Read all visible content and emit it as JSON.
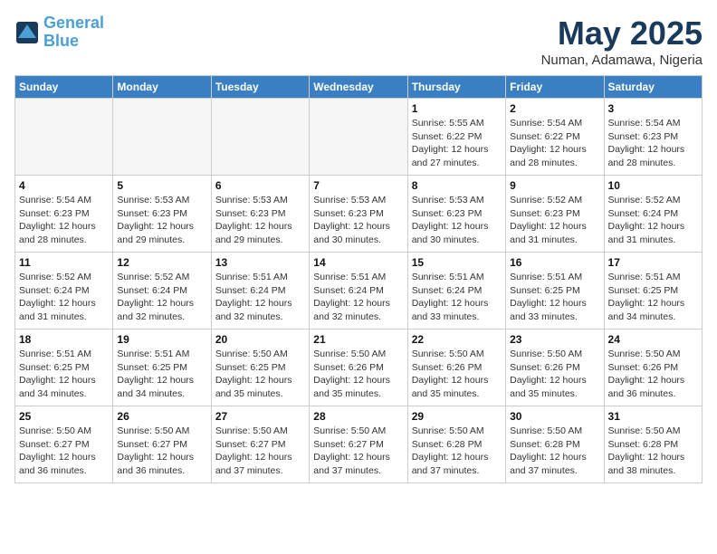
{
  "header": {
    "logo_line1": "General",
    "logo_line2": "Blue",
    "month": "May 2025",
    "location": "Numan, Adamawa, Nigeria"
  },
  "weekdays": [
    "Sunday",
    "Monday",
    "Tuesday",
    "Wednesday",
    "Thursday",
    "Friday",
    "Saturday"
  ],
  "weeks": [
    [
      {
        "day": "",
        "text": ""
      },
      {
        "day": "",
        "text": ""
      },
      {
        "day": "",
        "text": ""
      },
      {
        "day": "",
        "text": ""
      },
      {
        "day": "1",
        "text": "Sunrise: 5:55 AM\nSunset: 6:22 PM\nDaylight: 12 hours\nand 27 minutes."
      },
      {
        "day": "2",
        "text": "Sunrise: 5:54 AM\nSunset: 6:22 PM\nDaylight: 12 hours\nand 28 minutes."
      },
      {
        "day": "3",
        "text": "Sunrise: 5:54 AM\nSunset: 6:23 PM\nDaylight: 12 hours\nand 28 minutes."
      }
    ],
    [
      {
        "day": "4",
        "text": "Sunrise: 5:54 AM\nSunset: 6:23 PM\nDaylight: 12 hours\nand 28 minutes."
      },
      {
        "day": "5",
        "text": "Sunrise: 5:53 AM\nSunset: 6:23 PM\nDaylight: 12 hours\nand 29 minutes."
      },
      {
        "day": "6",
        "text": "Sunrise: 5:53 AM\nSunset: 6:23 PM\nDaylight: 12 hours\nand 29 minutes."
      },
      {
        "day": "7",
        "text": "Sunrise: 5:53 AM\nSunset: 6:23 PM\nDaylight: 12 hours\nand 30 minutes."
      },
      {
        "day": "8",
        "text": "Sunrise: 5:53 AM\nSunset: 6:23 PM\nDaylight: 12 hours\nand 30 minutes."
      },
      {
        "day": "9",
        "text": "Sunrise: 5:52 AM\nSunset: 6:23 PM\nDaylight: 12 hours\nand 31 minutes."
      },
      {
        "day": "10",
        "text": "Sunrise: 5:52 AM\nSunset: 6:24 PM\nDaylight: 12 hours\nand 31 minutes."
      }
    ],
    [
      {
        "day": "11",
        "text": "Sunrise: 5:52 AM\nSunset: 6:24 PM\nDaylight: 12 hours\nand 31 minutes."
      },
      {
        "day": "12",
        "text": "Sunrise: 5:52 AM\nSunset: 6:24 PM\nDaylight: 12 hours\nand 32 minutes."
      },
      {
        "day": "13",
        "text": "Sunrise: 5:51 AM\nSunset: 6:24 PM\nDaylight: 12 hours\nand 32 minutes."
      },
      {
        "day": "14",
        "text": "Sunrise: 5:51 AM\nSunset: 6:24 PM\nDaylight: 12 hours\nand 32 minutes."
      },
      {
        "day": "15",
        "text": "Sunrise: 5:51 AM\nSunset: 6:24 PM\nDaylight: 12 hours\nand 33 minutes."
      },
      {
        "day": "16",
        "text": "Sunrise: 5:51 AM\nSunset: 6:25 PM\nDaylight: 12 hours\nand 33 minutes."
      },
      {
        "day": "17",
        "text": "Sunrise: 5:51 AM\nSunset: 6:25 PM\nDaylight: 12 hours\nand 34 minutes."
      }
    ],
    [
      {
        "day": "18",
        "text": "Sunrise: 5:51 AM\nSunset: 6:25 PM\nDaylight: 12 hours\nand 34 minutes."
      },
      {
        "day": "19",
        "text": "Sunrise: 5:51 AM\nSunset: 6:25 PM\nDaylight: 12 hours\nand 34 minutes."
      },
      {
        "day": "20",
        "text": "Sunrise: 5:50 AM\nSunset: 6:25 PM\nDaylight: 12 hours\nand 35 minutes."
      },
      {
        "day": "21",
        "text": "Sunrise: 5:50 AM\nSunset: 6:26 PM\nDaylight: 12 hours\nand 35 minutes."
      },
      {
        "day": "22",
        "text": "Sunrise: 5:50 AM\nSunset: 6:26 PM\nDaylight: 12 hours\nand 35 minutes."
      },
      {
        "day": "23",
        "text": "Sunrise: 5:50 AM\nSunset: 6:26 PM\nDaylight: 12 hours\nand 35 minutes."
      },
      {
        "day": "24",
        "text": "Sunrise: 5:50 AM\nSunset: 6:26 PM\nDaylight: 12 hours\nand 36 minutes."
      }
    ],
    [
      {
        "day": "25",
        "text": "Sunrise: 5:50 AM\nSunset: 6:27 PM\nDaylight: 12 hours\nand 36 minutes."
      },
      {
        "day": "26",
        "text": "Sunrise: 5:50 AM\nSunset: 6:27 PM\nDaylight: 12 hours\nand 36 minutes."
      },
      {
        "day": "27",
        "text": "Sunrise: 5:50 AM\nSunset: 6:27 PM\nDaylight: 12 hours\nand 37 minutes."
      },
      {
        "day": "28",
        "text": "Sunrise: 5:50 AM\nSunset: 6:27 PM\nDaylight: 12 hours\nand 37 minutes."
      },
      {
        "day": "29",
        "text": "Sunrise: 5:50 AM\nSunset: 6:28 PM\nDaylight: 12 hours\nand 37 minutes."
      },
      {
        "day": "30",
        "text": "Sunrise: 5:50 AM\nSunset: 6:28 PM\nDaylight: 12 hours\nand 37 minutes."
      },
      {
        "day": "31",
        "text": "Sunrise: 5:50 AM\nSunset: 6:28 PM\nDaylight: 12 hours\nand 38 minutes."
      }
    ]
  ]
}
